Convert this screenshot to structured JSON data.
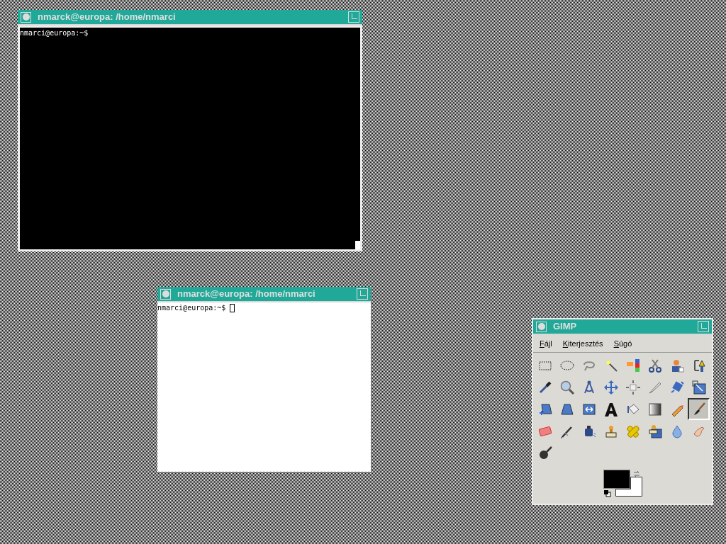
{
  "terminals": [
    {
      "title": "nmarck@europa: /home/nmarci",
      "kind": "dark",
      "lines": [
        "nmarci@europa:~$"
      ],
      "cursor": false
    },
    {
      "title": "nmarck@europa: /home/nmarci",
      "kind": "light",
      "lines": [
        "nmarci@europa:~$"
      ],
      "cursor": true
    }
  ],
  "toolbox": {
    "title": "GIMP",
    "menu": [
      {
        "mnemonic": "F",
        "rest": "ájl"
      },
      {
        "mnemonic": "K",
        "rest": "iterjesztés"
      },
      {
        "mnemonic": "S",
        "rest": "úgó"
      }
    ],
    "tools": [
      {
        "kind": "rect",
        "selected": false
      },
      {
        "kind": "ellipse",
        "selected": false
      },
      {
        "kind": "lasso",
        "selected": false
      },
      {
        "kind": "wand",
        "selected": false
      },
      {
        "kind": "blocks",
        "selected": false
      },
      {
        "kind": "scissors",
        "selected": false
      },
      {
        "kind": "person",
        "selected": false
      },
      {
        "kind": "nib",
        "selected": false
      },
      {
        "kind": "dropper",
        "selected": false
      },
      {
        "kind": "magnifier",
        "selected": false
      },
      {
        "kind": "compass",
        "selected": false
      },
      {
        "kind": "move",
        "selected": false
      },
      {
        "kind": "align",
        "selected": false
      },
      {
        "kind": "knife",
        "selected": false
      },
      {
        "kind": "rotate",
        "selected": false
      },
      {
        "kind": "scale",
        "selected": false
      },
      {
        "kind": "shear",
        "selected": false
      },
      {
        "kind": "perspective",
        "selected": false
      },
      {
        "kind": "flip",
        "selected": false
      },
      {
        "kind": "letter",
        "selected": false
      },
      {
        "kind": "bucket",
        "selected": false
      },
      {
        "kind": "gradient",
        "selected": false
      },
      {
        "kind": "pencil",
        "selected": false
      },
      {
        "kind": "brush",
        "selected": true
      },
      {
        "kind": "eraser",
        "selected": false
      },
      {
        "kind": "airbrush",
        "selected": false
      },
      {
        "kind": "ink",
        "selected": false
      },
      {
        "kind": "stamp",
        "selected": false
      },
      {
        "kind": "heal",
        "selected": false
      },
      {
        "kind": "stamp2",
        "selected": false
      },
      {
        "kind": "drop",
        "selected": false
      },
      {
        "kind": "smudge",
        "selected": false
      },
      {
        "kind": "dodge",
        "selected": false
      }
    ],
    "foreground": {
      "color": "#000000"
    },
    "background": {
      "color": "#ffffff"
    }
  }
}
